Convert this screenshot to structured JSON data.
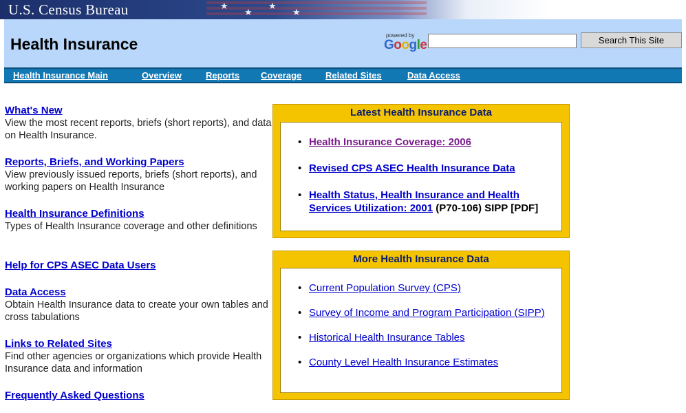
{
  "banner": {
    "brand": "U.S. Census Bureau"
  },
  "header": {
    "title": "Health Insurance",
    "powered_by": "powered by",
    "google_logo": "Google",
    "search_value": "",
    "search_button": "Search This Site"
  },
  "nav": {
    "items": [
      "Health Insurance Main",
      "Overview",
      "Reports",
      "Coverage",
      "Related Sites",
      "Data Access"
    ]
  },
  "left": {
    "items": [
      {
        "title": "What's New",
        "desc": "View the most recent reports, briefs (short reports), and data on Health Insurance."
      },
      {
        "title": "Reports, Briefs, and Working Papers",
        "desc": "View previously issued reports, briefs (short reports), and working papers on Health Insurance"
      },
      {
        "title": "Health Insurance Definitions",
        "desc": "Types of Health Insurance coverage and other definitions"
      },
      {
        "title": "Help for CPS ASEC Data Users",
        "desc": ""
      },
      {
        "title": "Data Access",
        "desc": "Obtain Health Insurance data to create your own tables and cross tabulations"
      },
      {
        "title": "Links to Related Sites",
        "desc": "Find other agencies or organizations which provide Health Insurance data and information"
      },
      {
        "title": "Frequently Asked Questions",
        "desc": ""
      }
    ]
  },
  "latest": {
    "heading": "Latest Health Insurance Data",
    "items": [
      {
        "link": "Health Insurance Coverage: 2006",
        "suffix": ""
      },
      {
        "link": "Revised CPS ASEC Health Insurance Data",
        "suffix": ""
      },
      {
        "link": "Health Status, Health Insurance and Health Services Utilization: 2001",
        "suffix": " (P70-106) SIPP  [PDF]"
      }
    ]
  },
  "more": {
    "heading": "More Health Insurance Data",
    "items": [
      "Current Population Survey (CPS)",
      "Survey of Income and Program Participation (SIPP)",
      "Historical Health Insurance Tables",
      "County Level Health Insurance Estimates"
    ]
  },
  "colors": {
    "banner_dark": "#1c2f6b",
    "header_bg": "#b9d7fa",
    "nav_bg": "#1278b4",
    "box_gold": "#f5c400",
    "link": "#0000cc",
    "visited_link": "#7a1a8c"
  }
}
